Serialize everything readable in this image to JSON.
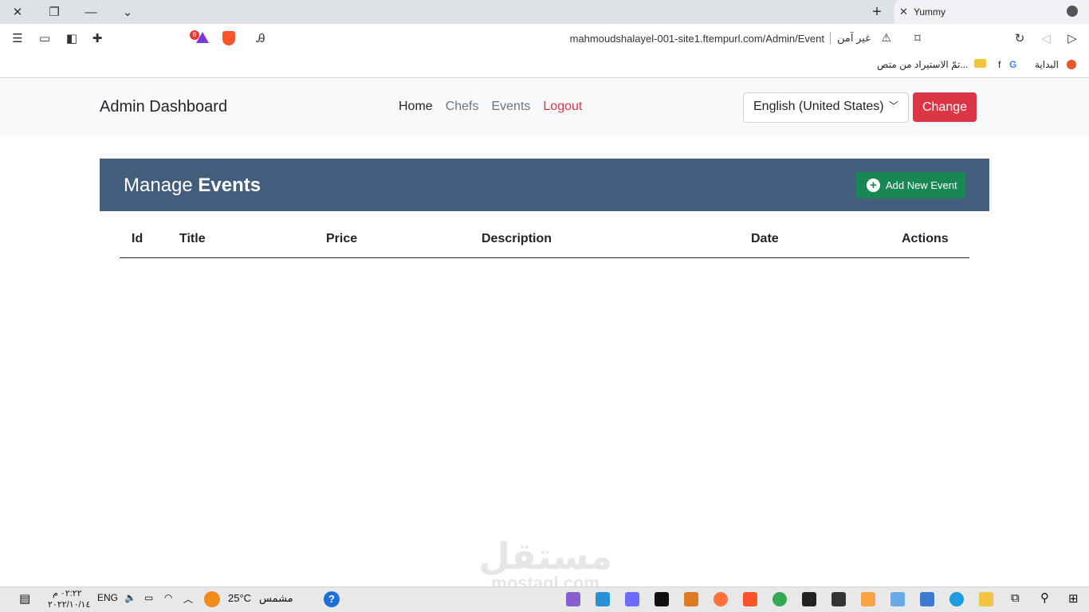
{
  "browser": {
    "tab_title": "Yummy",
    "url": "mahmoudshalayel-001-site1.ftempurl.com/Admin/Event",
    "security_text": "غير آمن",
    "shields_count": "8",
    "bookmarks": [
      "البداية",
      "f",
      "تمّ الاستيراد من متص..."
    ]
  },
  "navbar": {
    "brand": "Admin Dashboard",
    "links": [
      "Home",
      "Chefs",
      "Events",
      "Logout"
    ],
    "language_select": "English (United States)",
    "change_button": "Change"
  },
  "panel": {
    "title_prefix": "Manage",
    "title_bold": "Events",
    "add_button": "Add New Event"
  },
  "table": {
    "headers": [
      "Id",
      "Title",
      "Price",
      "Description",
      "Date",
      "Actions"
    ],
    "rows": []
  },
  "watermark": {
    "arabic": "مستقل",
    "latin": "mostaql.com"
  },
  "taskbar": {
    "time": "٠٢:٢٢ م",
    "date": "٢٠٢٢/١٠/١٤",
    "language": "ENG",
    "temperature": "25°C",
    "weather": "مشمس"
  },
  "colors": {
    "panel_header": "#435d7d",
    "add_button": "#198754",
    "change_button": "#dc3545",
    "logout_link": "#dc3545"
  }
}
